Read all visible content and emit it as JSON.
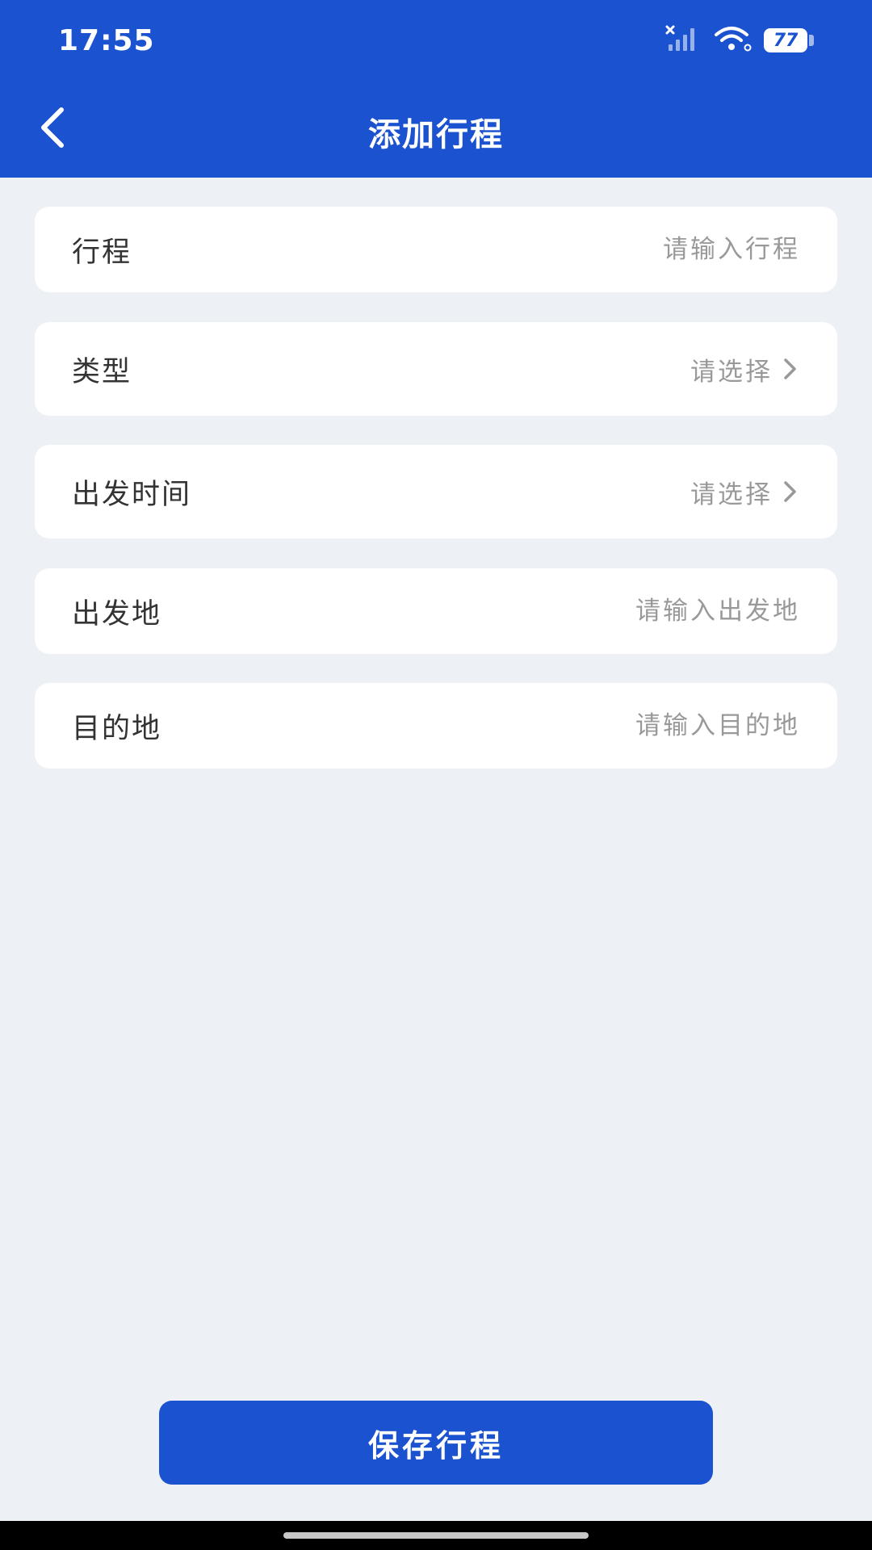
{
  "status_bar": {
    "time": "17:55",
    "battery": "77",
    "icons": [
      "signal-off-icon",
      "wifi-icon",
      "battery-icon"
    ]
  },
  "nav": {
    "title": "添加行程",
    "back_icon": "back-arrow-icon"
  },
  "form": {
    "fields": [
      {
        "label": "行程",
        "placeholder": "请输入行程",
        "kind": "input"
      },
      {
        "label": "类型",
        "value": "请选择",
        "kind": "select"
      },
      {
        "label": "出发时间",
        "value": "请选择",
        "kind": "select"
      },
      {
        "label": "出发地",
        "placeholder": "请输入出发地",
        "kind": "input"
      },
      {
        "label": "目的地",
        "placeholder": "请输入目的地",
        "kind": "input"
      }
    ]
  },
  "actions": {
    "save_label": "保存行程"
  },
  "colors": {
    "primary": "#1a52d0",
    "background": "#edf0f5",
    "card": "#ffffff",
    "label": "#333333",
    "placeholder": "#999999"
  }
}
